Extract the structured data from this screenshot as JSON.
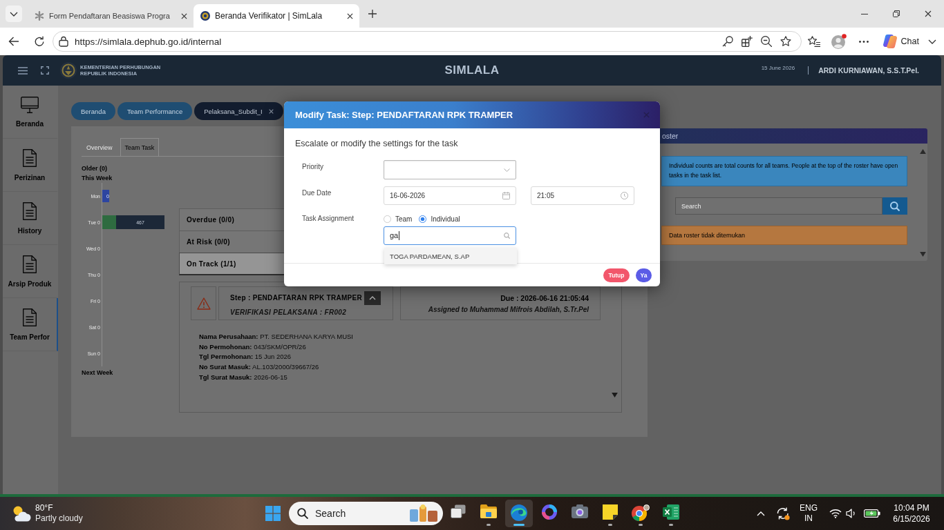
{
  "browser": {
    "tabs": [
      {
        "title": "Form Pendaftaran Beasiswa Progra",
        "selected": false
      },
      {
        "title": "Beranda Verifikator | SimLala",
        "selected": true
      }
    ],
    "url": "https://simlala.dephub.go.id/internal",
    "copilot_label": "Chat"
  },
  "app_header": {
    "org_lines": [
      "KEMENTERIAN PERHUBUNGAN",
      "REPUBLIK INDONESIA"
    ],
    "title": "SIMLALA",
    "date": "15 June 2026",
    "user": "ARDI KURNIAWAN, S.S.T.Pel."
  },
  "sidebar": {
    "items": [
      {
        "label": "Beranda",
        "selected": false
      },
      {
        "label": "Perizinan",
        "selected": false
      },
      {
        "label": "History",
        "selected": false
      },
      {
        "label": "Arsip Produk",
        "selected": false
      },
      {
        "label": "Team Perfor",
        "selected": true
      }
    ]
  },
  "breadcrumbs": [
    {
      "label": "Beranda",
      "selected": false,
      "closable": false
    },
    {
      "label": "Team Performance",
      "selected": false,
      "closable": false
    },
    {
      "label": "Pelaksana_Subdit_I",
      "selected": true,
      "closable": true
    }
  ],
  "team_task": {
    "tabs": [
      {
        "label": "Overview",
        "selected": false
      },
      {
        "label": "Team Task",
        "selected": true
      }
    ],
    "older": "Older (0)",
    "this_week": "This Week",
    "days": [
      {
        "label": "Mon",
        "kind": "marker",
        "bar_text": "0"
      },
      {
        "label": "Tue 0",
        "kind": "split",
        "bar_text": "467"
      },
      {
        "label": "Wed 0",
        "kind": "plain"
      },
      {
        "label": "Thu 0",
        "kind": "plain"
      },
      {
        "label": "Fri 0",
        "kind": "plain"
      },
      {
        "label": "Sat 0",
        "kind": "plain"
      },
      {
        "label": "Sun 0",
        "kind": "plain"
      }
    ],
    "next_week": "Next Week",
    "groups": [
      {
        "label": "Overdue (0/0)",
        "expanded": false
      },
      {
        "label": "At Risk (0/0)",
        "expanded": false
      },
      {
        "label": "On Track (1/1)",
        "expanded": true,
        "task": {
          "step": "Step : PENDAFTARAN RPK TRAMPER",
          "stage": "VERIFIKASI PELAKSANA : FR002",
          "due": "Due : 2026-06-16 21:05:44",
          "assigned": "Assigned to Muhammad Mifrois Abdilah, S.Tr.Pel",
          "details": [
            "**Nama Perusahaan:** PT. SEDERHANA KARYA MUSI",
            "**No Permohonan:** 043/SKM/OPR/26",
            "**Tgl Permohonan:** 15 Jun 2026",
            "**No Surat Masuk:** AL.103/2000/39667/26",
            "**Tgl Surat Masuk:** 2026-06-15"
          ]
        }
      }
    ]
  },
  "roster": {
    "title": "oster",
    "info": "Individual counts are total counts for all teams. People at the top of the roster have open tasks in the task list.",
    "search": {
      "placeholder": "Search"
    },
    "empty_message": "Data roster tidak ditemukan"
  },
  "modal": {
    "title": "Modify Task: Step: PENDAFTARAN RPK TRAMPER",
    "intro": "Escalate or modify the settings for the task",
    "priority": {
      "label": "Priority"
    },
    "due_date": {
      "label": "Due Date",
      "date": "16-06-2026",
      "time": "21:05"
    },
    "assignment": {
      "label": "Task Assignment",
      "options": [
        {
          "label": "Team",
          "selected": false
        },
        {
          "label": "Individual",
          "selected": true
        }
      ],
      "search": {
        "value": "ga",
        "focused": true
      },
      "suggestions": [
        "TOGA PARDAMEAN, S.AP"
      ]
    },
    "buttons": [
      {
        "label": "Tutup",
        "kind": "cancel"
      },
      {
        "label": "Ya",
        "kind": "confirm"
      }
    ]
  },
  "taskbar": {
    "weather": {
      "temperature": "80°F",
      "condition": "Partly cloudy"
    },
    "search": {
      "label": "Search"
    },
    "apps": [
      {
        "running": false,
        "active": false
      },
      {
        "running": true,
        "active": false
      },
      {
        "running": true,
        "active": true
      },
      {
        "running": false,
        "active": false
      },
      {
        "running": false,
        "active": false
      },
      {
        "running": true,
        "active": false
      },
      {
        "running": true,
        "active": false
      },
      {
        "running": true,
        "active": false
      }
    ],
    "language": {
      "code": "ENG",
      "region": "IN"
    },
    "time": "10:04 PM",
    "date": "6/15/2026"
  }
}
